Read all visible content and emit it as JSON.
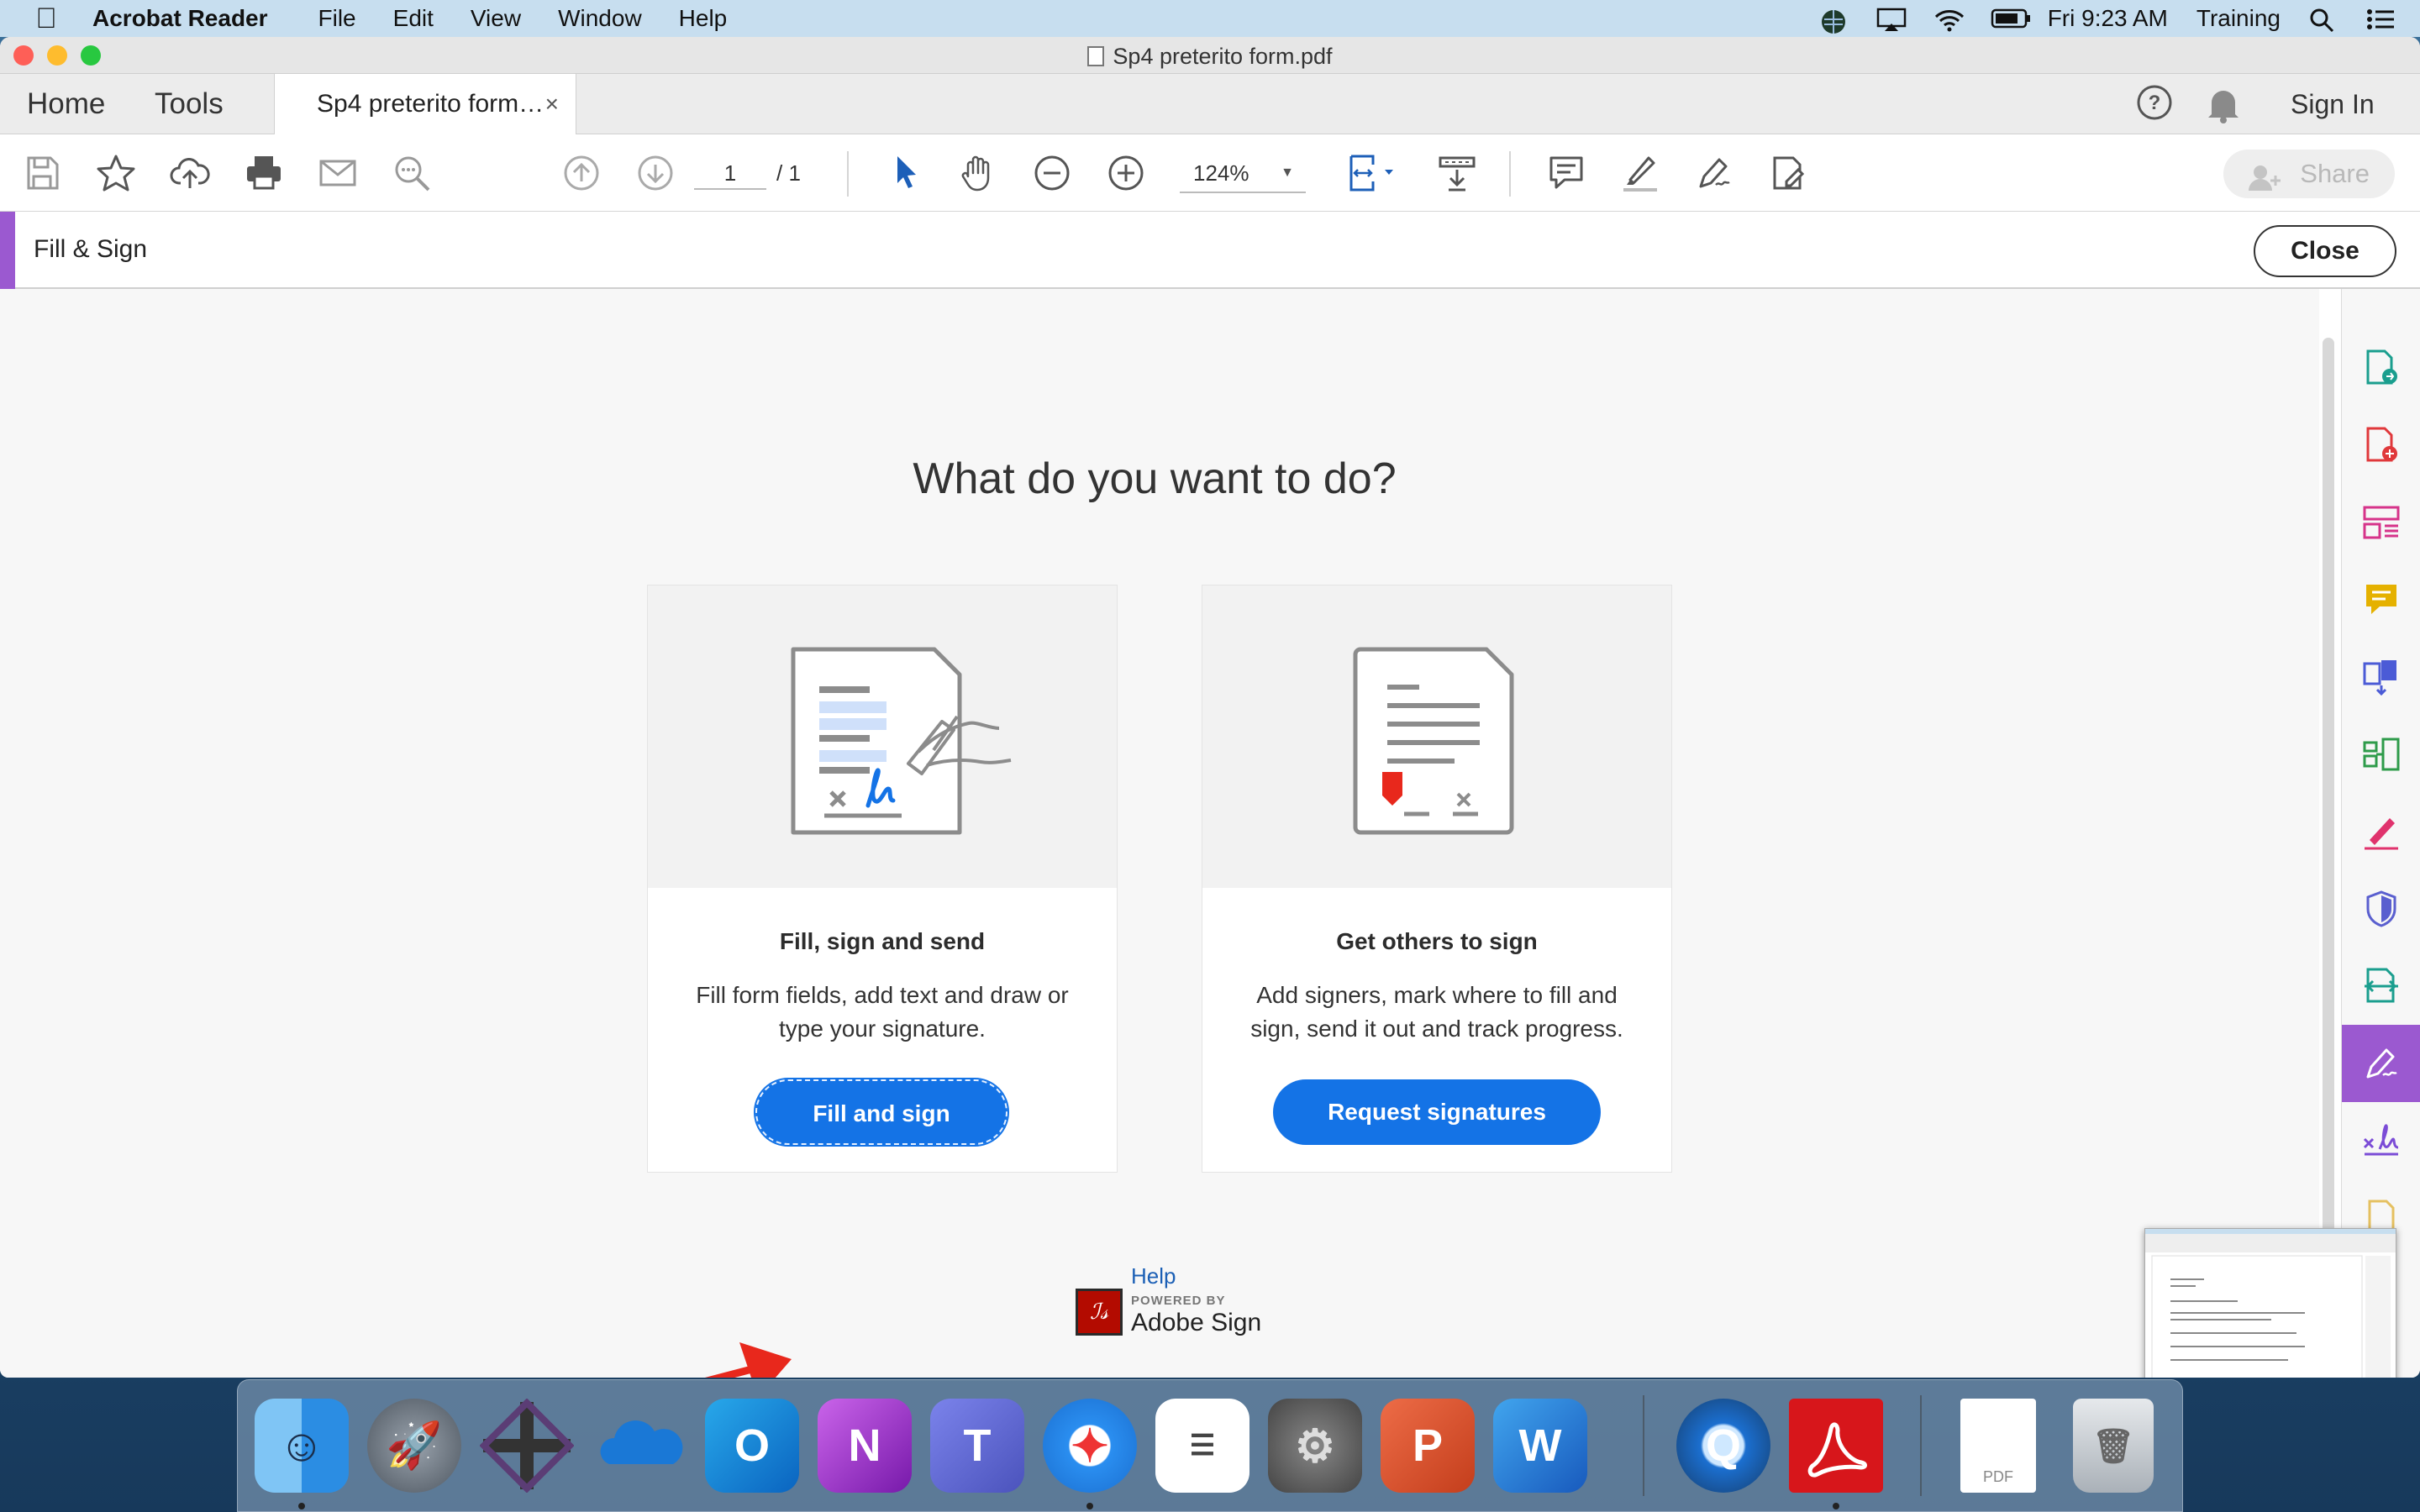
{
  "menubar": {
    "app_name": "Acrobat Reader",
    "items": [
      "File",
      "Edit",
      "View",
      "Window",
      "Help"
    ],
    "clock": "Fri 9:23 AM",
    "user": "Training"
  },
  "window": {
    "title": "Sp4 preterito form.pdf"
  },
  "tabs": {
    "home": "Home",
    "tools": "Tools",
    "document": "Sp4 preterito form…",
    "close_symbol": "×",
    "sign_in": "Sign In"
  },
  "toolbar": {
    "page_current": "1",
    "page_total": "/ 1",
    "zoom": "124%",
    "share": "Share"
  },
  "fill_sign": {
    "title": "Fill & Sign",
    "close": "Close",
    "heading": "What do you want to do?",
    "cards": [
      {
        "title": "Fill, sign and send",
        "description": "Fill form fields, add text and draw or type your signature.",
        "button": "Fill and sign"
      },
      {
        "title": "Get others to sign",
        "description": "Add signers, mark where to fill and sign, send it out and track progress.",
        "button": "Request signatures"
      }
    ],
    "help": "Help",
    "powered_by": "POWERED BY",
    "brand": "Adobe Sign"
  },
  "colors": {
    "accent_purple": "#9b59d0",
    "button_blue": "#1473e6",
    "annotation_red": "#e8281c"
  },
  "dock": {
    "apps": [
      "finder",
      "launchpad",
      "app-cross",
      "onedrive",
      "outlook",
      "onenote",
      "teams",
      "safari",
      "reminders",
      "system-preferences",
      "powerpoint",
      "word",
      "quicktime",
      "acrobat-reader",
      "pdf-document",
      "trash"
    ],
    "pdf_label": "PDF"
  }
}
